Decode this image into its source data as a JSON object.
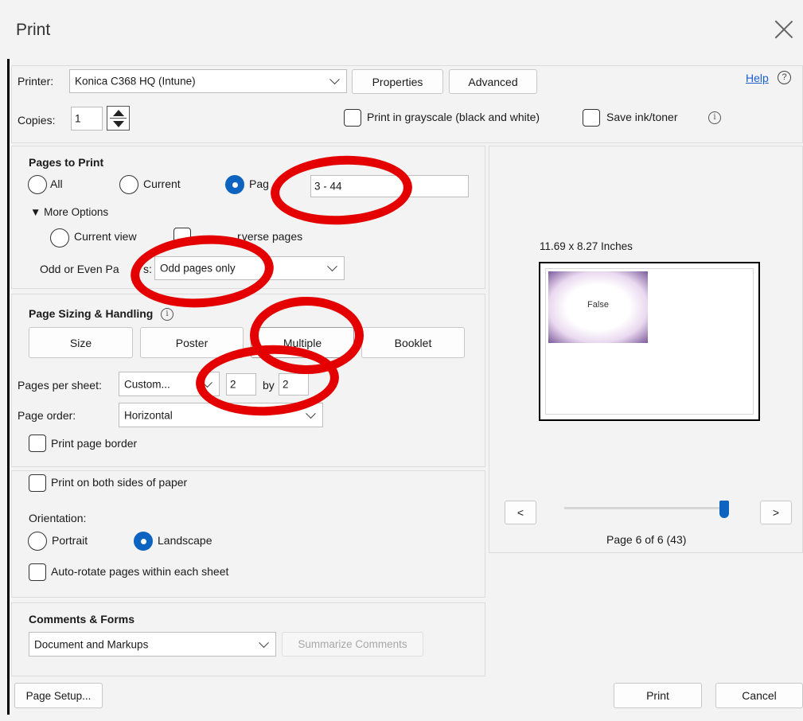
{
  "window": {
    "title": "Print"
  },
  "printer": {
    "label": "Printer:",
    "value": "Konica C368 HQ (Intune)",
    "properties_label": "Properties",
    "advanced_label": "Advanced",
    "help_label": "Help",
    "help_icon": "?"
  },
  "copies": {
    "label": "Copies:",
    "value": "1",
    "grayscale_label": "Print in grayscale (black and white)",
    "save_ink_label": "Save ink/toner",
    "info_icon": "i"
  },
  "pages_to_print": {
    "heading": "Pages to Print",
    "all_label": "All",
    "current_label": "Current",
    "pages_label": "Pag",
    "pages_value": "3 - 44",
    "more_options_label": "▼ More Options",
    "current_view_label": "Current view",
    "reverse_pages_label": "r verse pages",
    "odd_even_label": "Odd or Even Pa",
    "odd_even_label_tail": "s:",
    "odd_even_value": "Odd pages only"
  },
  "page_sizing": {
    "heading": "Page Sizing & Handling",
    "info_icon": "i",
    "size_label": "Size",
    "poster_label": "Poster",
    "multiple_label": "Multiple",
    "booklet_label": "Booklet",
    "per_sheet_label": "Pages per sheet:",
    "per_sheet_value": "Custom...",
    "cols_value": "2",
    "by_label": "by",
    "rows_value": "2",
    "order_label": "Page order:",
    "order_value": "Horizontal",
    "border_label": "Print page border"
  },
  "duplex": {
    "both_sides_label": "Print on both sides of paper",
    "orientation_label": "Orientation:",
    "portrait_label": "Portrait",
    "landscape_label": "Landscape",
    "autorotate_label": "Auto-rotate pages within each sheet"
  },
  "comments": {
    "heading": "Comments & Forms",
    "value": "Document and Markups",
    "summarize_label": "Summarize Comments"
  },
  "preview": {
    "size_label": "11.69 x 8.27 Inches",
    "thumb_text": "False",
    "prev_label": "<",
    "next_label": ">",
    "page_status": "Page 6 of 6 (43)",
    "slider_position": 1.0
  },
  "footer": {
    "page_setup_label": "Page Setup...",
    "print_label": "Print",
    "cancel_label": "Cancel"
  },
  "colors": {
    "accent": "#0c64c0",
    "annotation": "#e40000",
    "link": "#1a5fd0",
    "thumb": "#7b5a9b"
  }
}
